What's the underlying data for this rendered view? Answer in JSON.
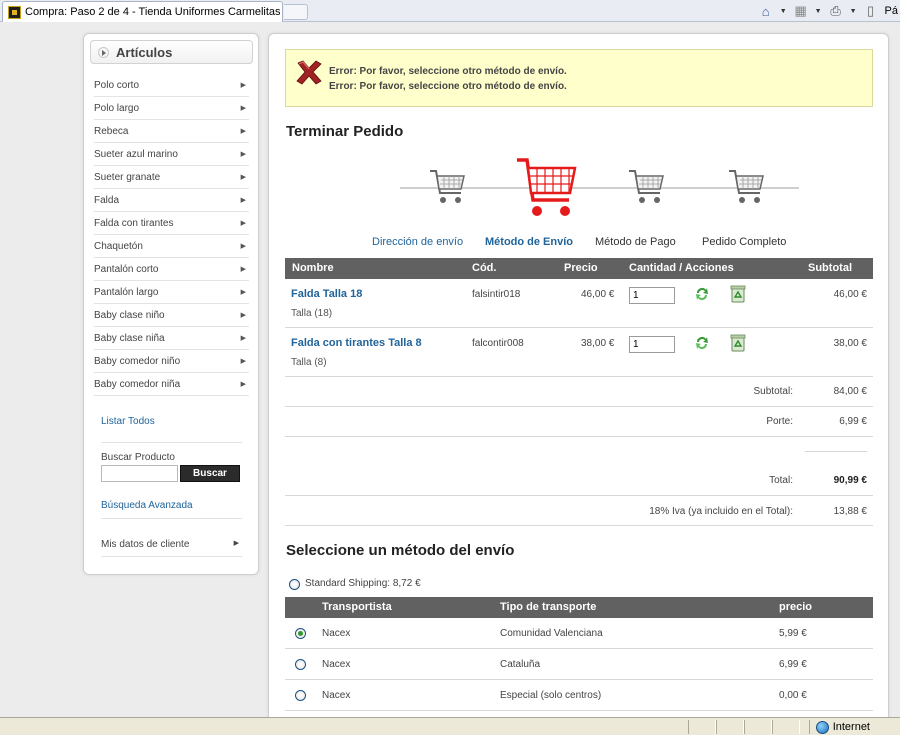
{
  "browser": {
    "tab_title": "Compra: Paso 2 de 4 - Tienda Uniformes Carmelitas",
    "cmd_text": "Pá",
    "status_zone": "Internet"
  },
  "sidebar": {
    "title": "Artículos",
    "items": [
      {
        "label": "Polo corto"
      },
      {
        "label": "Polo largo"
      },
      {
        "label": "Rebeca"
      },
      {
        "label": "Sueter azul marino"
      },
      {
        "label": "Sueter granate"
      },
      {
        "label": "Falda"
      },
      {
        "label": "Falda con tirantes"
      },
      {
        "label": "Chaquetón"
      },
      {
        "label": "Pantalón corto"
      },
      {
        "label": "Pantalón largo"
      },
      {
        "label": "Baby clase niño"
      },
      {
        "label": "Baby clase niña"
      },
      {
        "label": "Baby comedor niño"
      },
      {
        "label": "Baby comedor niña"
      }
    ],
    "list_all": "Listar Todos",
    "search_label": "Buscar Producto",
    "search_button": "Buscar",
    "advanced_search": "Búsqueda Avanzada",
    "client_data": "Mis datos de cliente"
  },
  "main": {
    "errors": [
      "Error: Por favor, seleccione otro método de envío.",
      "Error: Por favor, seleccione otro método de envío."
    ],
    "title": "Terminar Pedido",
    "steps": [
      {
        "label": "Dirección de envío",
        "state": "link"
      },
      {
        "label": "Método de Envío",
        "state": "active"
      },
      {
        "label": "Método de Pago",
        "state": "pending"
      },
      {
        "label": "Pedido Completo",
        "state": "pending"
      }
    ],
    "table_headers": {
      "name": "Nombre",
      "code": "Cód.",
      "price": "Precio",
      "qty": "Cantidad / Acciones",
      "subtotal": "Subtotal"
    },
    "products": [
      {
        "name": "Falda Talla 18",
        "size": "Talla (18)",
        "code": "falsintir018",
        "price": "46,00 €",
        "qty": "1",
        "subtotal": "46,00 €"
      },
      {
        "name": "Falda con tirantes Talla 8",
        "size": "Talla (8)",
        "code": "falcontir008",
        "price": "38,00 €",
        "qty": "1",
        "subtotal": "38,00 €"
      }
    ],
    "totals": {
      "subtotal_label": "Subtotal:",
      "subtotal_value": "84,00 €",
      "porte_label": "Porte:",
      "porte_value": "6,99 €",
      "total_label": "Total:",
      "total_value": "90,99 €",
      "iva_label": "18% Iva (ya incluido en el Total):",
      "iva_value": "13,88 €"
    },
    "shipping_title": "Seleccione un método del envío",
    "standard_shipping": "Standard Shipping: 8,72 €",
    "shipping_headers": {
      "carrier": "Transportista",
      "type": "Tipo de transporte",
      "price": "precio"
    },
    "shipping_options": [
      {
        "carrier": "Nacex",
        "type": "Comunidad Valenciana",
        "price": "5,99 €",
        "checked": true
      },
      {
        "carrier": "Nacex",
        "type": "Cataluña",
        "price": "6,99 €",
        "checked": false
      },
      {
        "carrier": "Nacex",
        "type": "Especial (solo centros)",
        "price": "0,00 €",
        "checked": false
      }
    ]
  }
}
